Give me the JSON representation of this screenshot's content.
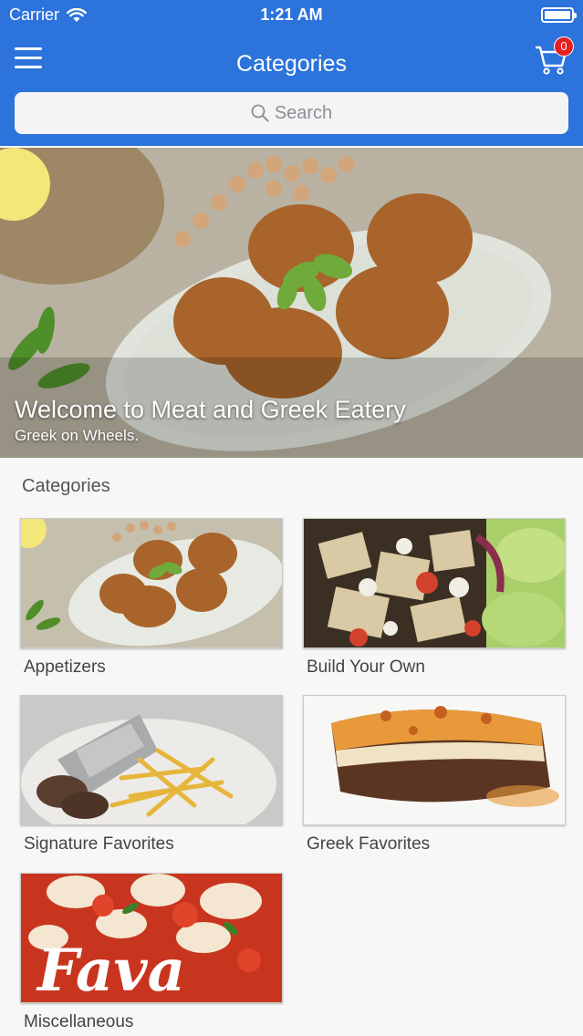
{
  "status": {
    "carrier": "Carrier",
    "time": "1:21 AM"
  },
  "nav": {
    "title": "Categories",
    "cart_count": "0"
  },
  "search": {
    "placeholder": "Search"
  },
  "hero": {
    "title": "Welcome to Meat and Greek Eatery",
    "subtitle": "Greek on Wheels."
  },
  "section_title": "Categories",
  "categories": [
    {
      "label": "Appetizers",
      "image": "falafel"
    },
    {
      "label": "Build Your Own",
      "image": "chicken-salad"
    },
    {
      "label": "Signature Favorites",
      "image": "gyro-fries"
    },
    {
      "label": "Greek Favorites",
      "image": "moussaka"
    },
    {
      "label": "Miscellaneous",
      "image": "fava-beans",
      "image_lettering": "Fava"
    }
  ],
  "colors": {
    "nav_bg": "#2c73db",
    "badge": "#e62020"
  }
}
